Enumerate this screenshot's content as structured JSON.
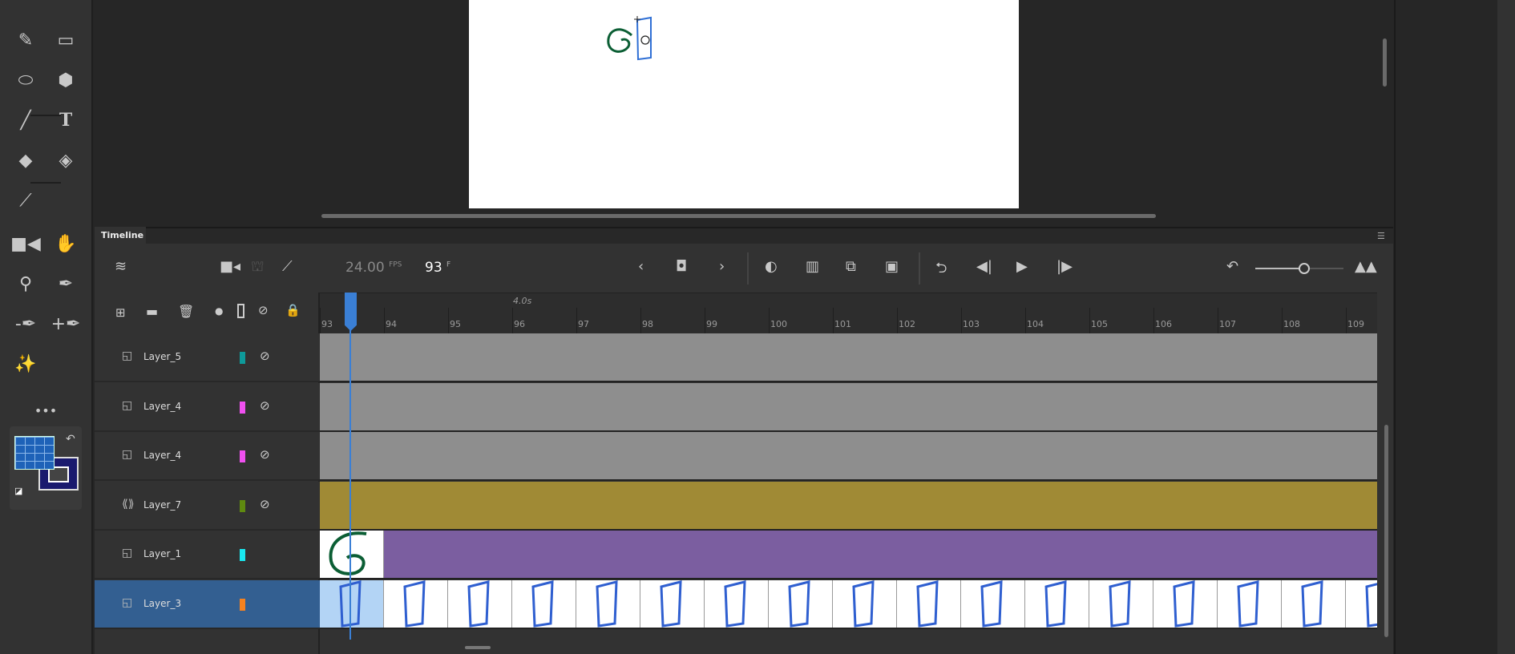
{
  "timeline": {
    "tab_label": "Timeline",
    "fps_value": "24.00",
    "fps_unit": "FPS",
    "frame_value": "93",
    "frame_unit": "F",
    "time_marker": "4.0s",
    "ruler_labels": [
      "93",
      "94",
      "95",
      "96",
      "97",
      "98",
      "99",
      "100",
      "101",
      "102",
      "103",
      "104",
      "105",
      "106",
      "107",
      "108",
      "109"
    ],
    "current_frame": 93,
    "layers": [
      {
        "name": "Layer_5",
        "icon": "layer-icon",
        "color": "#0e9a9a",
        "hidden": true,
        "track": "#8e8e8e"
      },
      {
        "name": "Layer_4",
        "icon": "layer-icon",
        "color": "#f050f0",
        "hidden": true,
        "track": "#8e8e8e"
      },
      {
        "name": "Layer_4",
        "icon": "layer-icon",
        "color": "#f050f0",
        "hidden": true,
        "track": "#8e8e8e"
      },
      {
        "name": "Layer_7",
        "icon": "motion-guide-icon",
        "color": "#5f8a10",
        "hidden": true,
        "track": "#a08a35"
      },
      {
        "name": "Layer_1",
        "icon": "layer-icon",
        "color": "#19e8f0",
        "hidden": false,
        "track": "#7b5ea0"
      },
      {
        "name": "Layer_3",
        "icon": "layer-icon",
        "color": "#f58220",
        "hidden": false,
        "track": "#ffffff",
        "selected": true
      }
    ]
  },
  "colors": {
    "accent": "#3a7fd5",
    "fill": "#1e62b8",
    "stroke": "#1a1a6e"
  }
}
